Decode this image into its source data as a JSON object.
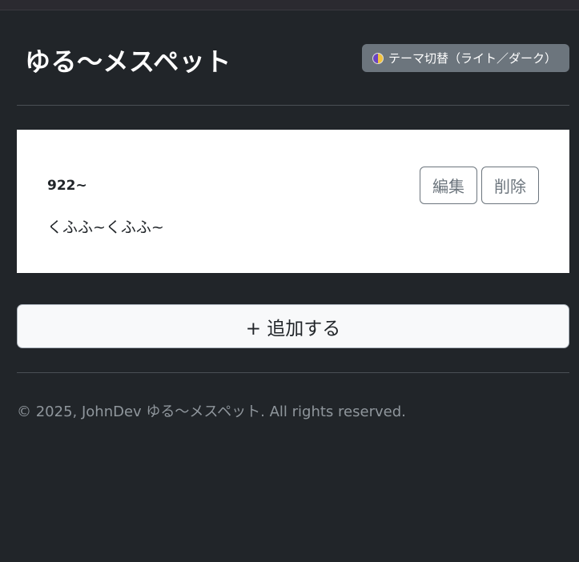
{
  "header": {
    "title": "ゆる～メスペット",
    "theme_toggle_label": "テーマ切替（ライト／ダーク）"
  },
  "posts": [
    {
      "title": "922~",
      "body": "くふふ~くふふ~",
      "edit_label": "編集",
      "delete_label": "削除"
    }
  ],
  "add_button_label": "+ 追加する",
  "footer": {
    "copyright": "© 2025, JohnDev ゆる～メスペット. All rights reserved."
  },
  "colors": {
    "background": "#212529",
    "card": "#ffffff",
    "toggle": "#6c757d"
  }
}
